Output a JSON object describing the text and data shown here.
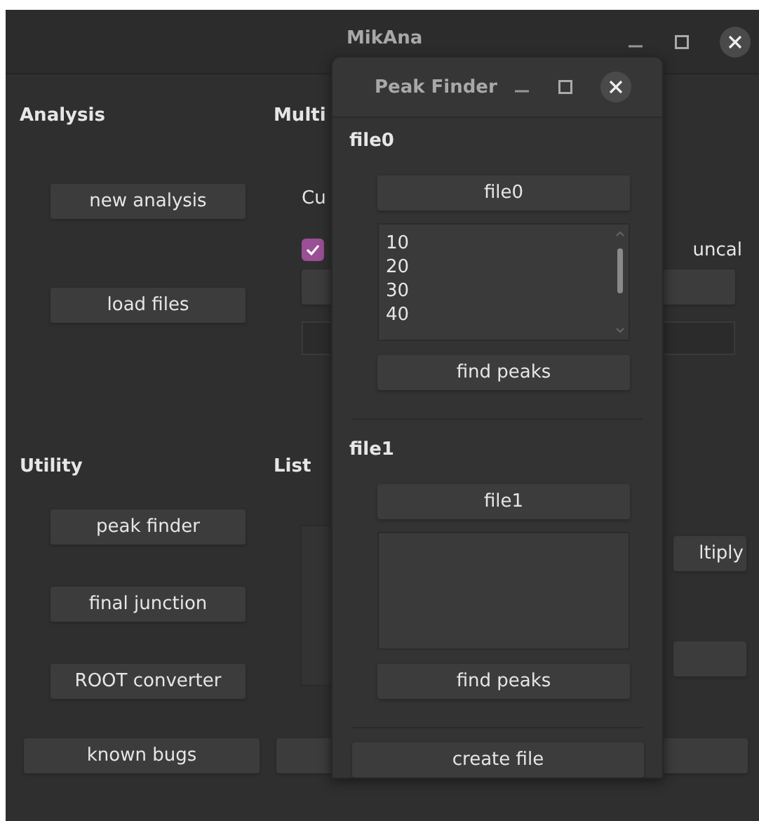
{
  "window": {
    "title": "MikAna"
  },
  "analysis": {
    "heading": "Analysis",
    "buttons": [
      "new analysis",
      "load files"
    ]
  },
  "multi": {
    "heading": "Multi",
    "label": "Cu",
    "checkbox": {
      "checked": true
    },
    "checkbox_label": "uncal"
  },
  "utility": {
    "heading": "Utility",
    "buttons": [
      "peak finder",
      "final junction",
      "ROOT converter"
    ]
  },
  "list": {
    "heading": "List",
    "button": "ltiply"
  },
  "footer": {
    "button": "known bugs"
  },
  "dialog": {
    "title": "Peak Finder",
    "files": [
      {
        "heading": "file0",
        "button": "file0",
        "items": [
          "10",
          "20",
          "30",
          "40"
        ],
        "action": "find peaks"
      },
      {
        "heading": "file1",
        "button": "file1",
        "action": "find peaks"
      }
    ],
    "create_button": "create file"
  }
}
